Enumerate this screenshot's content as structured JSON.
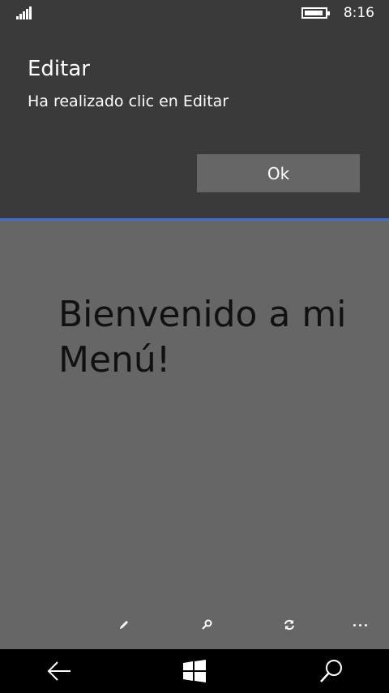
{
  "status_bar": {
    "time": "8:16",
    "signal_icon": "signal-icon",
    "battery_icon": "battery-icon",
    "battery_level": 0.9
  },
  "dialog": {
    "title": "Editar",
    "message": "Ha realizado clic en Editar",
    "ok_label": "Ok"
  },
  "main": {
    "welcome_text": "Bienvenido a mi Menú!"
  },
  "app_bar": {
    "buttons": [
      {
        "icon": "edit-icon"
      },
      {
        "icon": "search-icon"
      },
      {
        "icon": "refresh-icon"
      },
      {
        "icon": "more-icon"
      }
    ]
  },
  "nav_bar": {
    "buttons": [
      {
        "icon": "back-icon"
      },
      {
        "icon": "windows-icon"
      },
      {
        "icon": "search-icon"
      }
    ]
  },
  "colors": {
    "dialog_bg": "#3a3a3a",
    "page_bg": "#666666",
    "accent": "#3f6fd0",
    "nav_bg": "#000000"
  }
}
